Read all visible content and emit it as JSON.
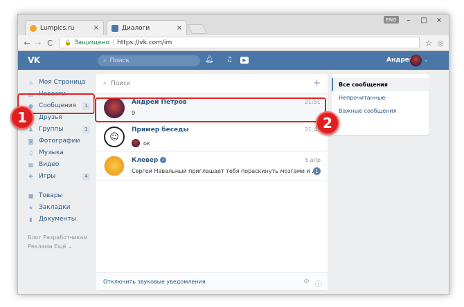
{
  "browser": {
    "tabs": [
      {
        "title": "Lumpics.ru",
        "close": "×"
      },
      {
        "title": "Диалоги",
        "close": "×"
      }
    ],
    "lang_badge": "ENG",
    "controls": {
      "minimize": "–",
      "maximize": "□",
      "close": "×"
    },
    "nav": {
      "back": "←",
      "forward": "→",
      "reload": "C"
    },
    "address": {
      "secure_label": "Защищено",
      "url": "https://vk.com/im"
    },
    "star": "☆",
    "menu": "⋮"
  },
  "vk": {
    "logo": "VK",
    "search_placeholder": "Поиск",
    "user_name": "Андрей",
    "accent": "#4a76a8"
  },
  "left_menu": {
    "items": [
      {
        "label": "Моя Страница",
        "icon": "home-icon",
        "count": ""
      },
      {
        "label": "Новости",
        "icon": "news-icon",
        "count": ""
      },
      {
        "label": "Сообщения",
        "icon": "messages-icon",
        "count": "1"
      },
      {
        "label": "Друзья",
        "icon": "friends-icon",
        "count": ""
      },
      {
        "label": "Группы",
        "icon": "groups-icon",
        "count": "1"
      },
      {
        "label": "Фотографии",
        "icon": "camera-icon",
        "count": ""
      },
      {
        "label": "Музыка",
        "icon": "music-icon",
        "count": ""
      },
      {
        "label": "Видео",
        "icon": "video-icon",
        "count": ""
      },
      {
        "label": "Игры",
        "icon": "gamepad-icon",
        "count": "4"
      },
      {
        "label": "Товары",
        "icon": "bag-icon",
        "count": ""
      },
      {
        "label": "Закладки",
        "icon": "star-icon",
        "count": ""
      },
      {
        "label": "Документы",
        "icon": "document-icon",
        "count": ""
      }
    ],
    "footer_line1": "Блог  Разработчикам",
    "footer_line2": "Реклама  Ещё ⌄"
  },
  "dialogs": {
    "search_placeholder": "Поиск",
    "conversations": [
      {
        "name": "Андрей Петров",
        "time": "21:51",
        "message": "9",
        "badge": ""
      },
      {
        "name": "Пример беседы",
        "time": "21:49",
        "message": "ок",
        "badge": ""
      },
      {
        "name": "Клевер",
        "time": "5 апр",
        "message": "Сергей Навальный приглашает тебя пораскинуть мозгами и …",
        "badge": "1"
      }
    ],
    "footer": "Отключить звуковые уведомления"
  },
  "filters": {
    "items": [
      "Все сообщения",
      "Непрочитанные",
      "Важные сообщения"
    ]
  },
  "annotations": {
    "marker1": "1",
    "marker2": "2",
    "highlight_color": "#dd2222"
  }
}
